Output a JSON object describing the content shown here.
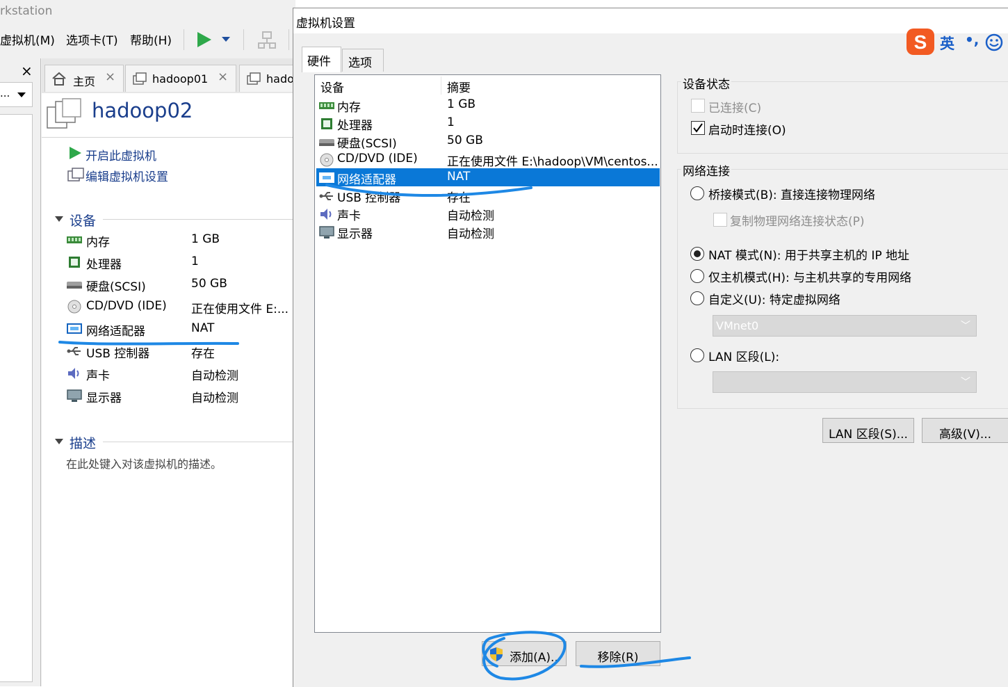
{
  "app": {
    "title": "rkstation"
  },
  "menu": {
    "items": [
      "虚拟机(M)",
      "选项卡(T)",
      "帮助(H)"
    ]
  },
  "tabs": [
    {
      "label": "主页",
      "close": "×"
    },
    {
      "label": "hadoop01",
      "close": "×"
    },
    {
      "label": "hado",
      "close": ""
    }
  ],
  "library": {
    "close": "×",
    "dropdown": "..."
  },
  "vm": {
    "name": "hadoop02",
    "actions": {
      "power_on": "开启此虚拟机",
      "edit_settings": "编辑虚拟机设置"
    },
    "devices_title": "设备",
    "devices": [
      {
        "icon": "memory-icon",
        "name": "内存",
        "value": "1 GB"
      },
      {
        "icon": "cpu-icon",
        "name": "处理器",
        "value": "1"
      },
      {
        "icon": "disk-icon",
        "name": "硬盘(SCSI)",
        "value": "50 GB"
      },
      {
        "icon": "cd-icon",
        "name": "CD/DVD (IDE)",
        "value": "正在使用文件 E:..."
      },
      {
        "icon": "network-icon",
        "name": "网络适配器",
        "value": "NAT"
      },
      {
        "icon": "usb-icon",
        "name": "USB 控制器",
        "value": "存在"
      },
      {
        "icon": "sound-icon",
        "name": "声卡",
        "value": "自动检测"
      },
      {
        "icon": "display-icon",
        "name": "显示器",
        "value": "自动检测"
      }
    ],
    "desc_title": "描述",
    "desc_placeholder": "在此处键入对该虚拟机的描述。"
  },
  "dialog": {
    "title": "虚拟机设置",
    "tabs": [
      "硬件",
      "选项"
    ],
    "list_headers": {
      "device": "设备",
      "summary": "摘要"
    },
    "devices": [
      {
        "icon": "memory-icon",
        "name": "内存",
        "value": "1 GB"
      },
      {
        "icon": "cpu-icon",
        "name": "处理器",
        "value": "1"
      },
      {
        "icon": "disk-icon",
        "name": "硬盘(SCSI)",
        "value": "50 GB"
      },
      {
        "icon": "cd-icon",
        "name": "CD/DVD (IDE)",
        "value": "正在使用文件 E:\\hadoop\\VM\\centos..."
      },
      {
        "icon": "network-icon",
        "name": "网络适配器",
        "value": "NAT",
        "selected": true
      },
      {
        "icon": "usb-icon",
        "name": "USB 控制器",
        "value": "存在"
      },
      {
        "icon": "sound-icon",
        "name": "声卡",
        "value": "自动检测"
      },
      {
        "icon": "display-icon",
        "name": "显示器",
        "value": "自动检测"
      }
    ],
    "buttons": {
      "add": "添加(A)..",
      "remove": "移除(R)",
      "lan_segments": "LAN 区段(S)...",
      "advanced": "高级(V)..."
    },
    "device_status": {
      "title": "设备状态",
      "connected": {
        "label": "已连接(C)",
        "checked": false,
        "enabled": false
      },
      "connect_at_power_on": {
        "label": "启动时连接(O)",
        "checked": true
      }
    },
    "network": {
      "title": "网络连接",
      "bridged": "桥接模式(B): 直接连接物理网络",
      "replicate": "复制物理网络连接状态(P)",
      "nat": "NAT 模式(N): 用于共享主机的 IP 地址",
      "host_only": "仅主机模式(H): 与主机共享的专用网络",
      "custom": "自定义(U): 特定虚拟网络",
      "custom_value": "VMnet0",
      "lan": "LAN 区段(L):",
      "lan_value": "",
      "selected": "nat"
    }
  },
  "ime": {
    "mode": "英",
    "punct": "•,"
  },
  "annotation_color": "#1e88e5"
}
